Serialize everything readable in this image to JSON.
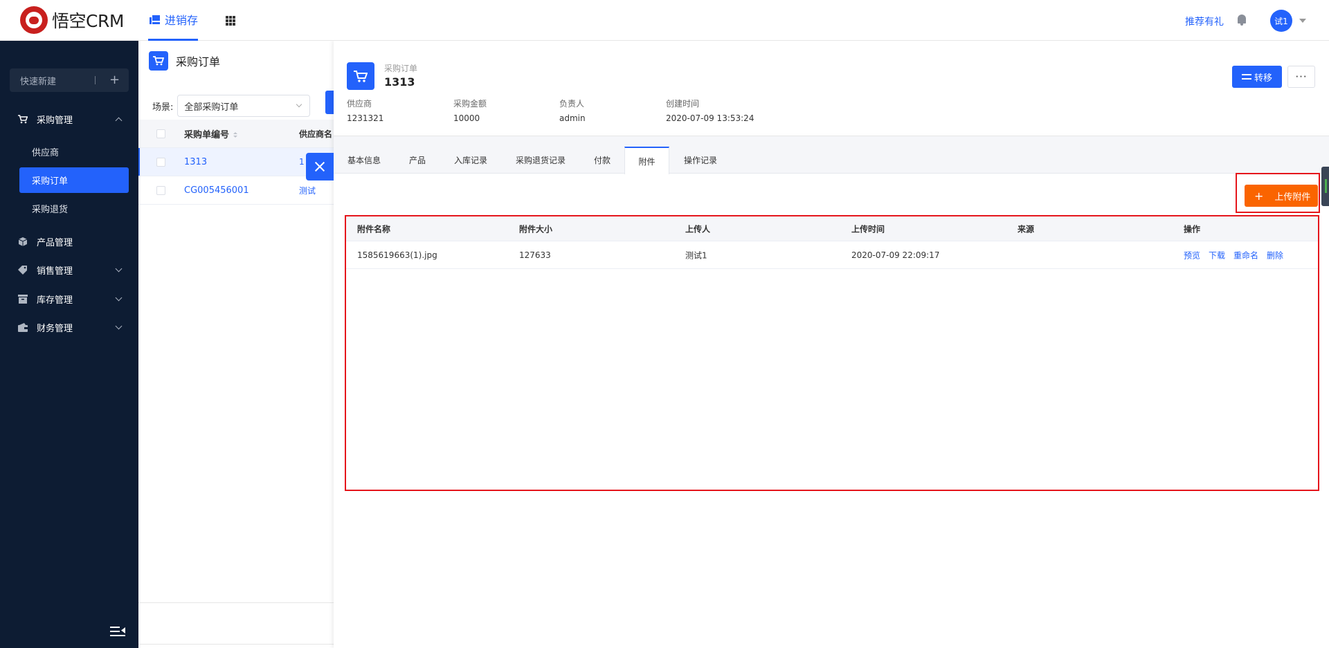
{
  "app": {
    "logo_text": "悟空CRM",
    "module": "进销存",
    "recommend": "推荐有礼",
    "avatar": "试1",
    "accent": "#2362fb",
    "sidebar_bg": "#0d1c33",
    "upload_color": "#fa6400",
    "highlight_color": "#e5151b"
  },
  "sidebar": {
    "quick_new": "快速新建",
    "groups": [
      {
        "label": "采购管理",
        "icon": "cart-icon",
        "expanded": true
      },
      {
        "label": "产品管理",
        "icon": "cube-icon"
      },
      {
        "label": "销售管理",
        "icon": "tag-icon"
      },
      {
        "label": "库存管理",
        "icon": "warehouse-icon"
      },
      {
        "label": "财务管理",
        "icon": "wallet-icon"
      }
    ],
    "sub_items": [
      {
        "label": "供应商"
      },
      {
        "label": "采购订单",
        "active": true
      },
      {
        "label": "采购退货"
      }
    ]
  },
  "list": {
    "title": "采购订单",
    "scene_label": "场景:",
    "scene_value": "全部采购订单",
    "columns": [
      "采购单编号",
      "供应商名"
    ],
    "rows": [
      {
        "code": "1313",
        "supplier": "1"
      },
      {
        "code": "CG005456001",
        "supplier": "测试"
      }
    ]
  },
  "detail": {
    "type_label": "采购订单",
    "title": "1313",
    "transfer_label": "转移",
    "more_label": "···",
    "meta": [
      {
        "key": "供应商",
        "value": "1231321"
      },
      {
        "key": "采购金额",
        "value": "10000"
      },
      {
        "key": "负责人",
        "value": "admin"
      },
      {
        "key": "创建时间",
        "value": "2020-07-09 13:53:24"
      }
    ],
    "tabs": [
      "基本信息",
      "产品",
      "入库记录",
      "采购退货记录",
      "付款",
      "附件",
      "操作记录"
    ],
    "active_tab": "附件",
    "upload_label": "上传附件",
    "attachments": {
      "columns": [
        "附件名称",
        "附件大小",
        "上传人",
        "上传时间",
        "来源",
        "操作"
      ],
      "rows": [
        {
          "name": "1585619663(1).jpg",
          "size": "127633",
          "uploader": "测试1",
          "time": "2020-07-09 22:09:17",
          "source": ""
        }
      ],
      "actions": [
        "预览",
        "下载",
        "重命名",
        "删除"
      ]
    }
  }
}
